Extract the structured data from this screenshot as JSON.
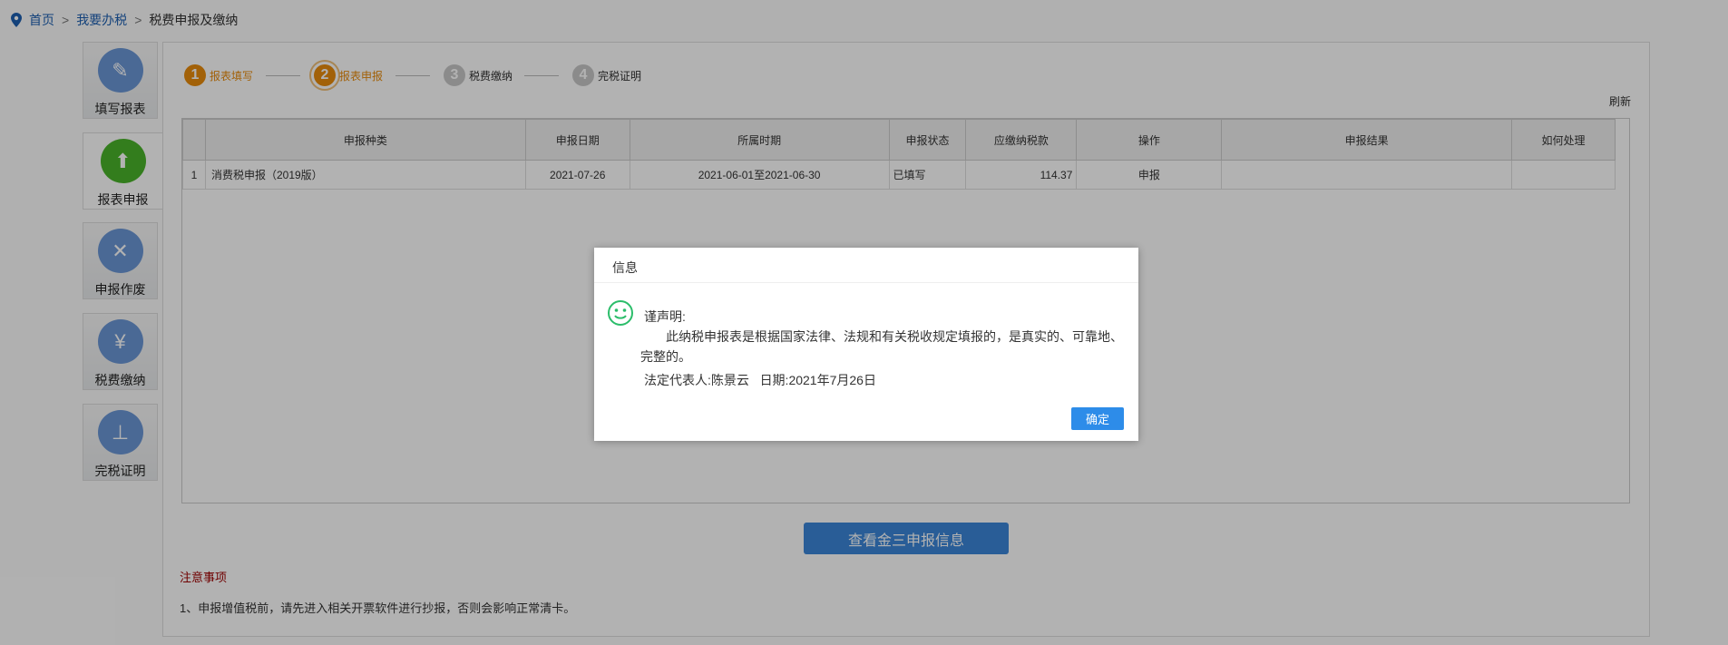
{
  "breadcrumb": {
    "home": "首页",
    "level1": "我要办税",
    "current": "税费申报及缴纳",
    "separator": ">"
  },
  "sidebar": [
    {
      "label": "填写报表",
      "icon": "pencil-icon"
    },
    {
      "label": "报表申报",
      "icon": "report-upload-icon"
    },
    {
      "label": "申报作废",
      "icon": "document-void-icon"
    },
    {
      "label": "税费缴纳",
      "icon": "payment-icon"
    },
    {
      "label": "完税证明",
      "icon": "stamp-icon"
    }
  ],
  "steps": [
    {
      "num": "1",
      "label": "报表填写"
    },
    {
      "num": "2",
      "label": "报表申报"
    },
    {
      "num": "3",
      "label": "税费缴纳"
    },
    {
      "num": "4",
      "label": "完税证明"
    }
  ],
  "refresh": "刷新",
  "table": {
    "headers": [
      "申报种类",
      "申报日期",
      "所属时期",
      "申报状态",
      "应缴纳税款",
      "操作",
      "申报结果",
      "如何处理"
    ],
    "rows": [
      {
        "index": "1",
        "type": "消费税申报（2019版）",
        "date": "2021-07-26",
        "period": "2021-06-01至2021-06-30",
        "status": "已填写",
        "amount": "114.37",
        "action": "申报",
        "result": "",
        "handle": ""
      }
    ]
  },
  "view_button": "查看金三申报信息",
  "notice": {
    "title": "注意事项",
    "items": [
      "1、申报增值税前，请先进入相关开票软件进行抄报，否则会影响正常清卡。"
    ]
  },
  "dialog": {
    "title": "信息",
    "heading": "谨声明:",
    "body": "此纳税申报表是根据国家法律、法规和有关税收规定填报的，是真实的、可靠地、完整的。",
    "signature": "法定代表人:陈景云",
    "date": "日期:2021年7月26日",
    "ok": "确定"
  },
  "colors": {
    "accent": "#e88b0c",
    "primary": "#2d8ce9",
    "active_green": "#49b42a",
    "notice_red": "#a00000"
  }
}
